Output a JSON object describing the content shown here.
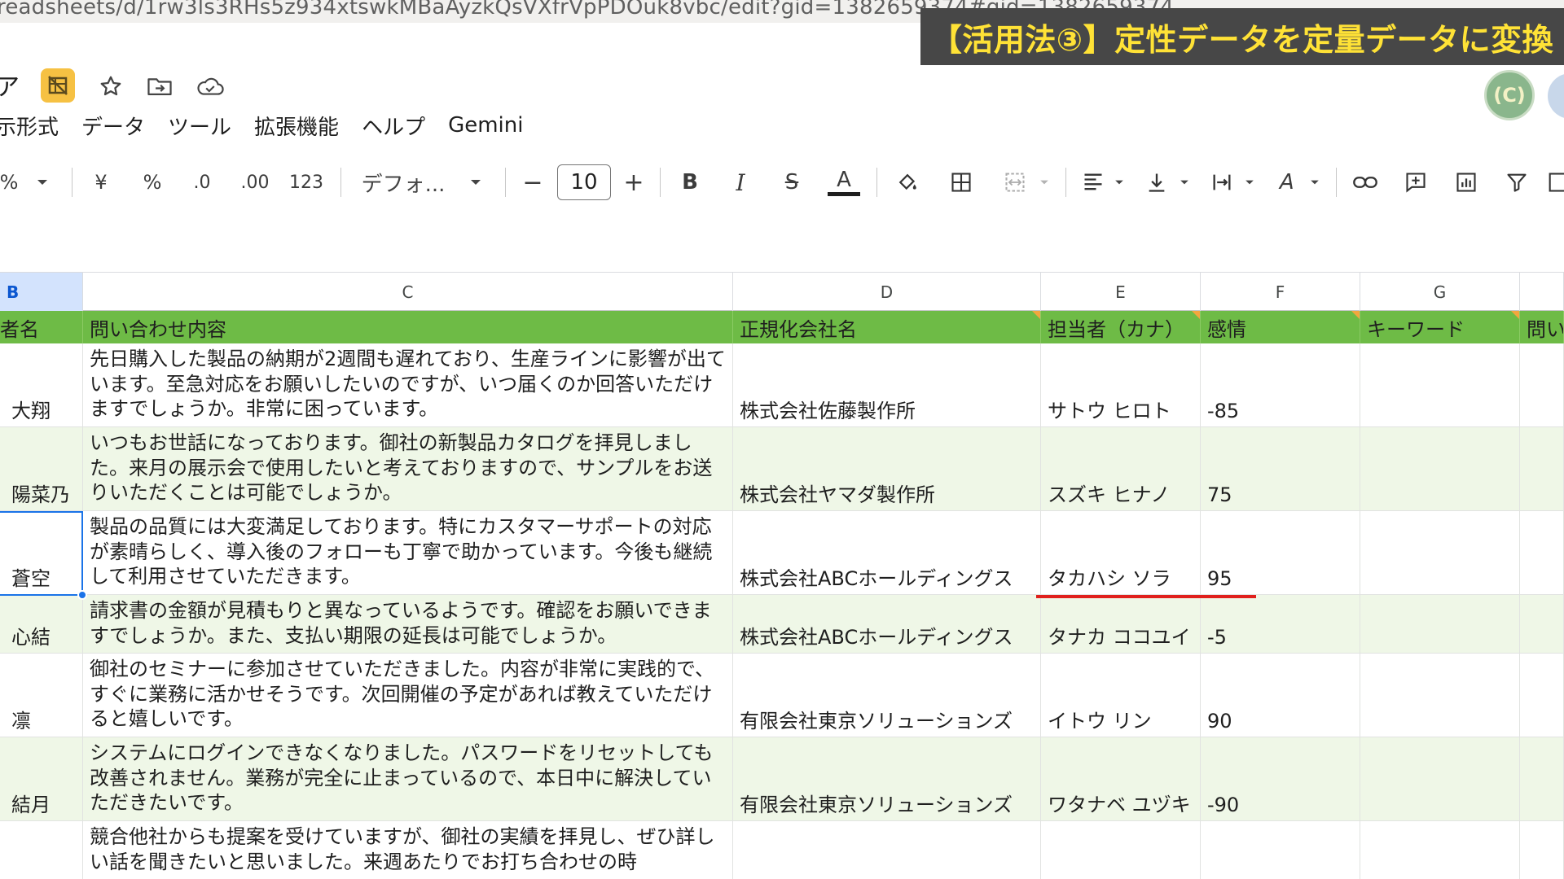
{
  "browser": {
    "url": "readsheets/d/1rw3ls3RHs5z934xtswkMBaAyzkQsVXfrVpPDOuk8vbc/edit?gid=1382659374#gid=1382659374"
  },
  "caption": {
    "text": "【活用法③】定性データを定量データに変換"
  },
  "titlebar": {
    "doc_fragment": "ア",
    "avatar_text": "(C)",
    "icons": [
      "sheet-badge-icon",
      "star-icon",
      "move-folder-icon",
      "cloud-icon"
    ]
  },
  "menu": {
    "items": [
      "示形式",
      "データ",
      "ツール",
      "拡張機能",
      "ヘルプ",
      "Gemini"
    ]
  },
  "toolbar": {
    "percent_fragment": "%",
    "currency": "¥",
    "percent": "%",
    "decrease_decimal": ".0",
    "increase_decimal": ".00",
    "number_format": "123",
    "font_name": "デフォ...",
    "font_size_minus": "−",
    "font_size": "10",
    "font_size_plus": "+",
    "bold": "B",
    "italic": "I",
    "strikethrough": "S",
    "text_color": "A",
    "rotate": "A"
  },
  "sheet": {
    "column_letters": [
      "B",
      "C",
      "D",
      "E",
      "F",
      "G",
      ""
    ],
    "headers": [
      "者名",
      "問い合わせ内容",
      "正規化会社名",
      "担当者（カナ）",
      "感情",
      "キーワード",
      "問い"
    ],
    "rows": [
      {
        "name": "大翔",
        "inquiry": "先日購入した製品の納期が2週間も遅れており、生産ラインに影響が出ています。至急対応をお願いしたいのですが、いつ届くのか回答いただけますでしょうか。非常に困っています。",
        "company": "株式会社佐藤製作所",
        "kana": "サトウ ヒロト",
        "sentiment": "-85",
        "keyword": ""
      },
      {
        "name": "陽菜乃",
        "inquiry": "いつもお世話になっております。御社の新製品カタログを拝見しました。来月の展示会で使用したいと考えておりますので、サンプルをお送りいただくことは可能でしょうか。",
        "company": "株式会社ヤマダ製作所",
        "kana": "スズキ ヒナノ",
        "sentiment": "75",
        "keyword": ""
      },
      {
        "name": "蒼空",
        "inquiry": "製品の品質には大変満足しております。特にカスタマーサポートの対応が素晴らしく、導入後のフォローも丁寧で助かっています。今後も継続して利用させていただきます。",
        "company": "株式会社ABCホールディングス",
        "kana": "タカハシ ソラ",
        "sentiment": "95",
        "keyword": ""
      },
      {
        "name": "心結",
        "inquiry": "請求書の金額が見積もりと異なっているようです。確認をお願いできますでしょうか。また、支払い期限の延長は可能でしょうか。",
        "company": "株式会社ABCホールディングス",
        "kana": "タナカ ココユイ",
        "sentiment": "-5",
        "keyword": ""
      },
      {
        "name": "凛",
        "inquiry": "御社のセミナーに参加させていただきました。内容が非常に実践的で、すぐに業務に活かせそうです。次回開催の予定があれば教えていただけると嬉しいです。",
        "company": "有限会社東京ソリューションズ",
        "kana": "イトウ リン",
        "sentiment": "90",
        "keyword": ""
      },
      {
        "name": "結月",
        "inquiry": "システムにログインできなくなりました。パスワードをリセットしても改善されません。業務が完全に止まっているので、本日中に解決していただきたいです。",
        "company": "有限会社東京ソリューションズ",
        "kana": "ワタナベ ユヅキ",
        "sentiment": "-90",
        "keyword": ""
      },
      {
        "name": "",
        "inquiry": "競合他社からも提案を受けていますが、御社の実績を拝見し、ぜひ詳しい話を聞きたいと思いました。来週あたりでお打ち合わせの時",
        "company": "",
        "kana": "",
        "sentiment": "",
        "keyword": ""
      }
    ]
  },
  "colors": {
    "header_green": "#6ebb46",
    "alt_row": "#eff7e7",
    "selection_blue": "#1a73e8",
    "annotation_red": "#e0201c",
    "caption_bg": "#474747",
    "caption_text": "#ffe236"
  }
}
